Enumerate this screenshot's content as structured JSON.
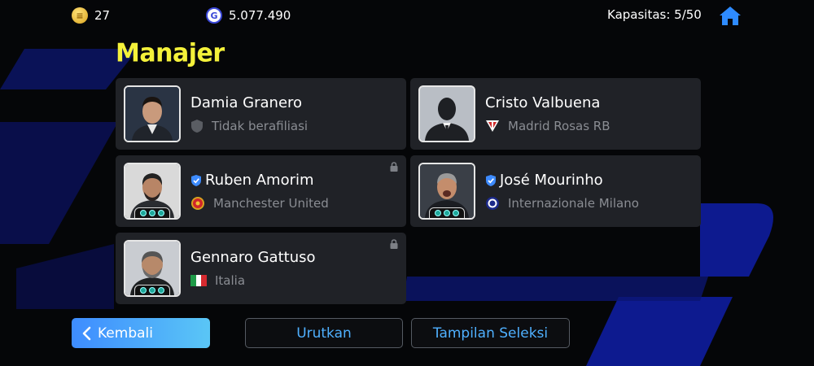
{
  "header": {
    "coins": "27",
    "coin_icon": "coin-icon",
    "gp": "5.077.490",
    "gp_icon_letter": "G",
    "capacity": "Kapasitas: 5/50"
  },
  "page_title": "Manajer",
  "managers": [
    {
      "name": "Damia Granero",
      "club": "Tidak berafiliasi",
      "verified": false,
      "locked": false,
      "skill_tag": false,
      "club_icon": "shield-icon"
    },
    {
      "name": "Cristo Valbuena",
      "club": "Madrid Rosas RB",
      "verified": false,
      "locked": false,
      "skill_tag": false,
      "club_icon": "club-crest-icon"
    },
    {
      "name": "Ruben Amorim",
      "club": "Manchester United",
      "verified": true,
      "locked": true,
      "skill_tag": true,
      "club_icon": "manchester-united-crest-icon"
    },
    {
      "name": "José Mourinho",
      "club": "Internazionale Milano",
      "verified": true,
      "locked": false,
      "skill_tag": true,
      "club_icon": "inter-milan-crest-icon"
    },
    {
      "name": "Gennaro Gattuso",
      "club": "Italia",
      "verified": false,
      "locked": true,
      "skill_tag": true,
      "club_icon": "italy-flag-icon"
    }
  ],
  "buttons": {
    "back": "Kembali",
    "sort": "Urutkan",
    "view": "Tampilan Seleksi"
  },
  "colors": {
    "accent_yellow": "#f4f13a",
    "card_bg": "#202227",
    "button_text_blue": "#4fb0ff",
    "back_button_gradient_start": "#3e8cff",
    "back_button_gradient_end": "#5ac6f6"
  }
}
